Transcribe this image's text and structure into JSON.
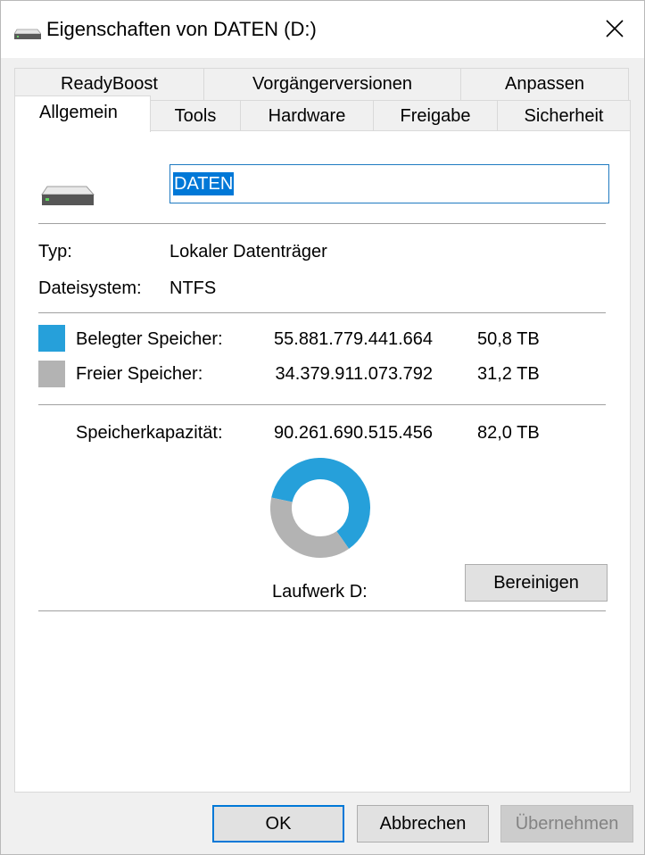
{
  "window": {
    "title": "Eigenschaften von DATEN (D:)",
    "close_glyph": "✕"
  },
  "tabs": {
    "row1": [
      "ReadyBoost",
      "Vorgängerversionen",
      "Anpassen"
    ],
    "row2": [
      "Allgemein",
      "Tools",
      "Hardware",
      "Freigabe",
      "Sicherheit"
    ],
    "active": "Allgemein"
  },
  "general": {
    "volume_name": "DATEN",
    "type_label": "Typ:",
    "type_value": "Lokaler Datenträger",
    "fs_label": "Dateisystem:",
    "fs_value": "NTFS",
    "used_label": "Belegter Speicher:",
    "used_bytes": "55.881.779.441.664",
    "used_size": "50,8 TB",
    "free_label": "Freier Speicher:",
    "free_bytes": "34.379.911.073.792",
    "free_size": "31,2 TB",
    "capacity_label": "Speicherkapazität:",
    "capacity_bytes": "90.261.690.515.456",
    "capacity_size": "82,0 TB",
    "drive_label": "Laufwerk D:",
    "cleanup_button": "Bereinigen"
  },
  "usage": {
    "used_fraction": 0.62,
    "used_color": "#26a0da",
    "free_color": "#b3b3b3"
  },
  "footer": {
    "ok": "OK",
    "cancel": "Abbrechen",
    "apply": "Übernehmen"
  },
  "icons": [
    "drive-icon",
    "close-icon"
  ]
}
